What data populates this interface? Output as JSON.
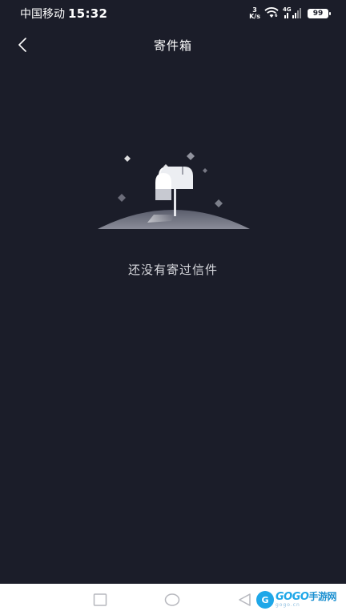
{
  "status_bar": {
    "carrier": "中国移动",
    "time": "15:32",
    "net_speed_value": "3",
    "net_speed_unit": "K/s",
    "signal_label": "4G",
    "battery": "99"
  },
  "header": {
    "title": "寄件箱"
  },
  "empty_state": {
    "message": "还没有寄过信件"
  },
  "watermark": {
    "badge": "G",
    "brand": "GOGO",
    "brand_cn": "手游网",
    "domain": "gogo.cn"
  },
  "icons": [
    "back-arrow-icon",
    "wifi-icon",
    "signal-icon",
    "battery-icon",
    "mailbox-illustration",
    "nav-square-icon",
    "nav-circle-icon",
    "nav-back-icon"
  ],
  "colors": {
    "background": "#1b1d29",
    "nav_background": "#ffffff",
    "text_primary": "#ffffff",
    "text_secondary": "#d8d9de"
  }
}
